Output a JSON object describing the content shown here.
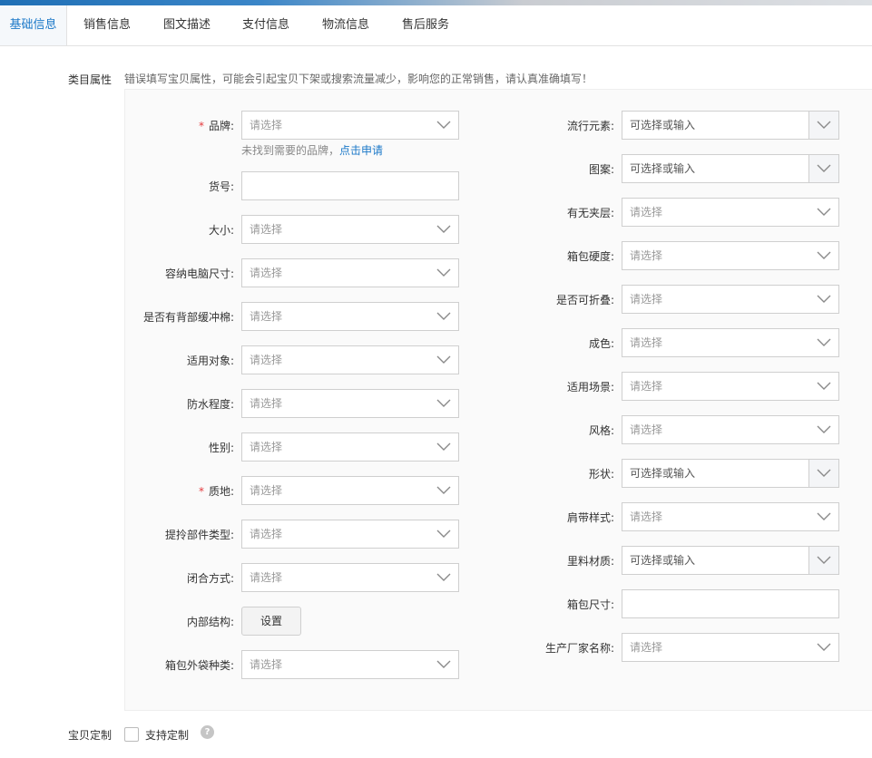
{
  "tabs": [
    {
      "label": "基础信息",
      "active": true
    },
    {
      "label": "销售信息"
    },
    {
      "label": "图文描述"
    },
    {
      "label": "支付信息"
    },
    {
      "label": "物流信息"
    },
    {
      "label": "售后服务"
    }
  ],
  "category": {
    "section_label": "类目属性",
    "notice": "错误填写宝贝属性，可能会引起宝贝下架或搜索流量减少，影响您的正常销售，请认真准确填写！"
  },
  "brand_hint": {
    "text": "未找到需要的品牌，",
    "link": "点击申请"
  },
  "left_fields": [
    {
      "label": "品牌:",
      "required": true,
      "type": "select",
      "placeholder": "请选择"
    },
    {
      "label": "货号:",
      "type": "text"
    },
    {
      "label": "大小:",
      "type": "select",
      "placeholder": "请选择"
    },
    {
      "label": "容纳电脑尺寸:",
      "type": "select",
      "placeholder": "请选择"
    },
    {
      "label": "是否有背部缓冲棉:",
      "type": "select",
      "placeholder": "请选择"
    },
    {
      "label": "适用对象:",
      "type": "select",
      "placeholder": "请选择"
    },
    {
      "label": "防水程度:",
      "type": "select",
      "placeholder": "请选择"
    },
    {
      "label": "性别:",
      "type": "select",
      "placeholder": "请选择"
    },
    {
      "label": "质地:",
      "required": true,
      "type": "select",
      "placeholder": "请选择"
    },
    {
      "label": "提拎部件类型:",
      "type": "select",
      "placeholder": "请选择"
    },
    {
      "label": "闭合方式:",
      "type": "select",
      "placeholder": "请选择"
    },
    {
      "label": "内部结构:",
      "type": "button",
      "button_label": "设置"
    },
    {
      "label": "箱包外袋种类:",
      "type": "select",
      "placeholder": "请选择"
    }
  ],
  "right_fields": [
    {
      "label": "流行元素:",
      "type": "combo",
      "placeholder": "可选择或输入"
    },
    {
      "label": "图案:",
      "type": "combo",
      "placeholder": "可选择或输入"
    },
    {
      "label": "有无夹层:",
      "type": "select",
      "placeholder": "请选择"
    },
    {
      "label": "箱包硬度:",
      "type": "select",
      "placeholder": "请选择"
    },
    {
      "label": "是否可折叠:",
      "type": "select",
      "placeholder": "请选择"
    },
    {
      "label": "成色:",
      "type": "select",
      "placeholder": "请选择"
    },
    {
      "label": "适用场景:",
      "type": "select",
      "placeholder": "请选择"
    },
    {
      "label": "风格:",
      "type": "select",
      "placeholder": "请选择"
    },
    {
      "label": "形状:",
      "type": "combo",
      "placeholder": "可选择或输入"
    },
    {
      "label": "肩带样式:",
      "type": "select",
      "placeholder": "请选择"
    },
    {
      "label": "里料材质:",
      "type": "combo",
      "placeholder": "可选择或输入"
    },
    {
      "label": "箱包尺寸:",
      "type": "text"
    },
    {
      "label": "生产厂家名称:",
      "type": "select",
      "placeholder": "请选择"
    }
  ],
  "custom": {
    "section_label": "宝贝定制",
    "checkbox_label": "支持定制",
    "checked": false,
    "help_icon": "question-icon"
  }
}
